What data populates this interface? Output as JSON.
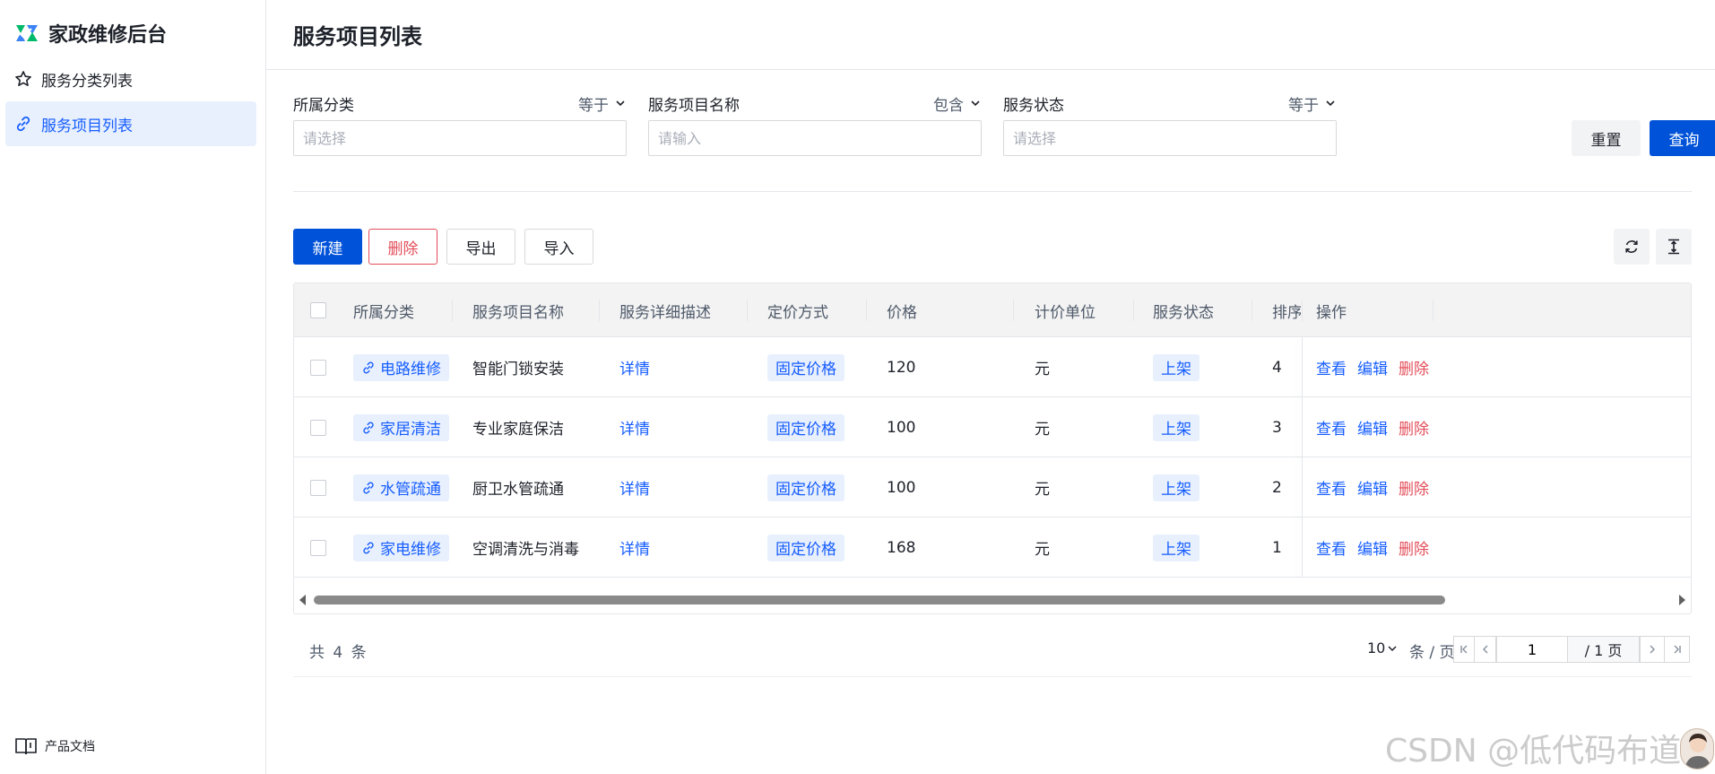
{
  "brand": {
    "title": "家政维修后台",
    "colors": {
      "primary": "#0052d9",
      "danger": "#e34d59",
      "logo_green": "#00b96b",
      "logo_blue": "#3b82f6"
    }
  },
  "sidebar": {
    "items": [
      {
        "label": "服务分类列表",
        "icon": "star-outline-icon",
        "active": false
      },
      {
        "label": "服务项目列表",
        "icon": "link-chain-icon",
        "active": true
      }
    ],
    "footer_label": "产品文档"
  },
  "page": {
    "title": "服务项目列表"
  },
  "filters": [
    {
      "label": "所属分类",
      "operator": "等于",
      "placeholder": "请选择"
    },
    {
      "label": "服务项目名称",
      "operator": "包含",
      "placeholder": "请输入"
    },
    {
      "label": "服务状态",
      "operator": "等于",
      "placeholder": "请选择"
    }
  ],
  "actions": {
    "reset": "重置",
    "query": "查询"
  },
  "toolbar": {
    "new": "新建",
    "delete": "删除",
    "export": "导出",
    "import": "导入"
  },
  "table": {
    "columns": [
      "所属分类",
      "服务项目名称",
      "服务详细描述",
      "定价方式",
      "价格",
      "计价单位",
      "服务状态",
      "排序值",
      "操作"
    ],
    "rows": [
      {
        "category": "电路维修",
        "name": "智能门锁安装",
        "detail": "详情",
        "pricing": "固定价格",
        "price": "120",
        "unit": "元",
        "status": "上架",
        "sort": "4"
      },
      {
        "category": "家居清洁",
        "name": "专业家庭保洁",
        "detail": "详情",
        "pricing": "固定价格",
        "price": "100",
        "unit": "元",
        "status": "上架",
        "sort": "3"
      },
      {
        "category": "水管疏通",
        "name": "厨卫水管疏通",
        "detail": "详情",
        "pricing": "固定价格",
        "price": "100",
        "unit": "元",
        "status": "上架",
        "sort": "2"
      },
      {
        "category": "家电维修",
        "name": "空调清洗与消毒",
        "detail": "详情",
        "pricing": "固定价格",
        "price": "168",
        "unit": "元",
        "status": "上架",
        "sort": "1"
      }
    ],
    "row_actions": {
      "view": "查看",
      "edit": "编辑",
      "delete": "删除"
    }
  },
  "pagination": {
    "total": "共 4 条",
    "page_size": "10",
    "per_page": "条 / 页",
    "current": "1",
    "pages": "/ 1 页"
  },
  "watermark": "CSDN @低代码布道师"
}
